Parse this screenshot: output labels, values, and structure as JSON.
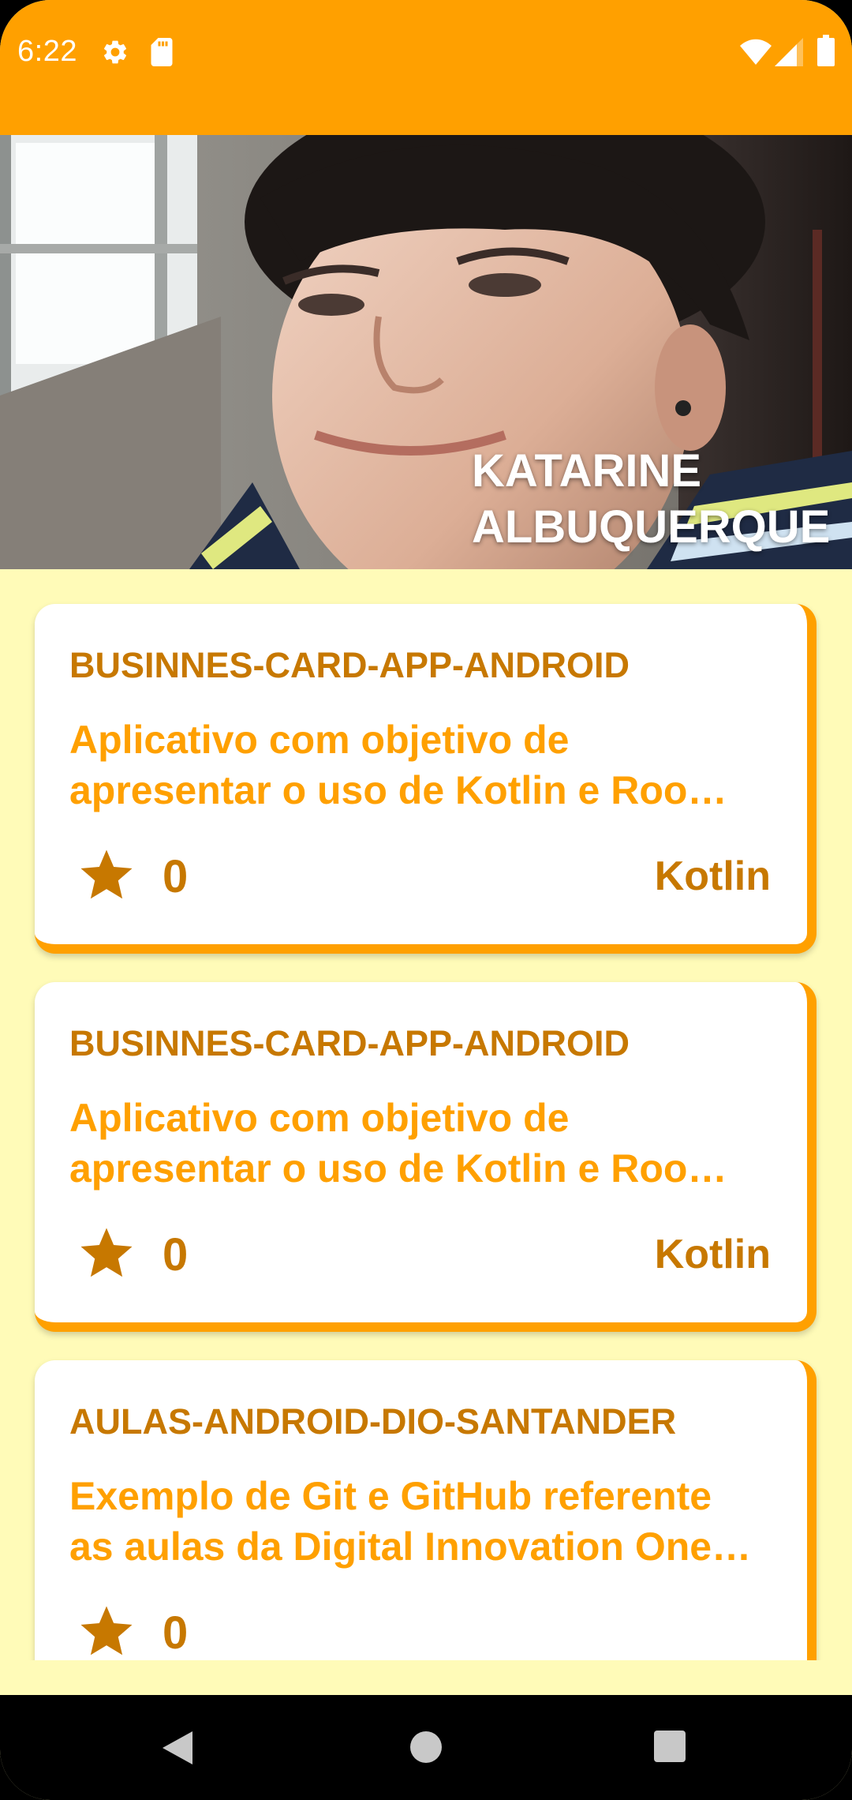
{
  "status_bar": {
    "time": "6:22",
    "left_icons": [
      "gear-icon",
      "sd-card-icon"
    ],
    "right_icons": [
      "wifi-icon",
      "signal-icon",
      "battery-icon"
    ]
  },
  "profile": {
    "name_line1": "KATARINE",
    "name_line2": "ALBUQUERQUE"
  },
  "repos": [
    {
      "name": "BUSINNES-CARD-APP-ANDROID",
      "description_line1": "Aplicativo com objetivo de",
      "description_line2": "apresentar o uso de Kotlin e Roo…",
      "stars": "0",
      "language": "Kotlin"
    },
    {
      "name": "BUSINNES-CARD-APP-ANDROID",
      "description_line1": "Aplicativo com objetivo de",
      "description_line2": "apresentar o uso de Kotlin e Roo…",
      "stars": "0",
      "language": "Kotlin"
    },
    {
      "name": "AULAS-ANDROID-DIO-SANTANDER",
      "description_line1": "Exemplo de Git e GitHub referente",
      "description_line2": "as aulas da Digital Innovation One…",
      "stars": "0",
      "language": ""
    }
  ],
  "nav_bar": {
    "buttons": [
      "back-icon",
      "home-icon",
      "recents-icon"
    ]
  },
  "colors": {
    "primary": "#FFA000",
    "primary_dark": "#C77800",
    "background": "#FFFBB8",
    "card": "#FFFFFF"
  }
}
